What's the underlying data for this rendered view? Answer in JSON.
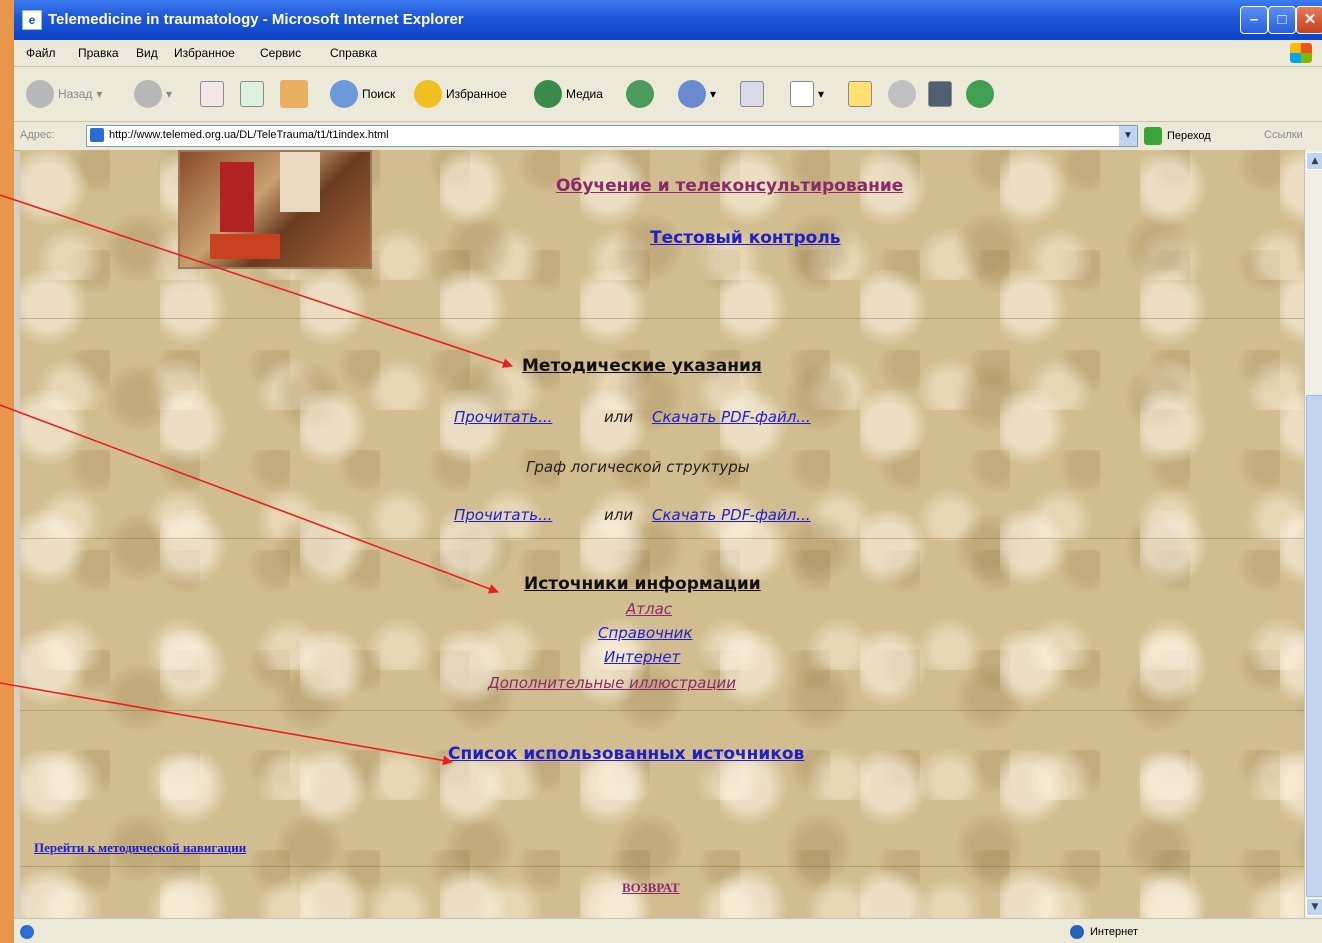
{
  "window": {
    "title": "Telemedicine in traumatology - Microsoft Internet Explorer"
  },
  "menu": [
    "Файл",
    "Правка",
    "Вид",
    "Избранное",
    "Сервис",
    "Справка"
  ],
  "toolbar": {
    "back": "Назад",
    "search": "Поиск",
    "favorites": "Избранное",
    "media": "Медиа"
  },
  "address": {
    "label": "Адрес:",
    "url": "http://www.telemed.org.ua/DL/TeleTrauma/t1/t1index.html",
    "go": "Переход",
    "links": "Ссылки"
  },
  "content": {
    "link_training": "Обучение и телеконсультирование",
    "link_test": "Тестовый контроль",
    "heading_methodical": "Методические указания",
    "read1": "Прочитать...",
    "or1": "или",
    "download1": "Скачать PDF-файл...",
    "graph_label": "Граф логической структуры",
    "read2": "Прочитать...",
    "or2": "или",
    "download2": "Скачать PDF-файл...",
    "heading_sources": "Источники информации",
    "link_atlas": "Атлас",
    "link_reference": "Справочник",
    "link_internet": "Интернет",
    "link_illustrations": "Дополнительные иллюстрации",
    "link_bibliography": "Список использованных источников",
    "link_nav": "Перейти к методической навигации",
    "link_back": "ВОЗВРАТ"
  },
  "status": {
    "zone": "Интернет"
  },
  "colors": {
    "link": "#2020c8",
    "visited": "#8a2a6a",
    "annotation_arrow": "#e8201c"
  }
}
